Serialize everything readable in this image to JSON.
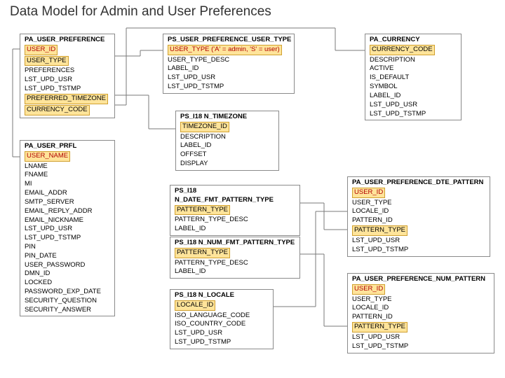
{
  "title": "Data Model for Admin and User Preferences",
  "entities": {
    "pa_user_preference": {
      "name": "PA_USER_PREFERENCE",
      "fields": [
        "USER_ID",
        "USER_TYPE",
        "PREFERENCES",
        "LST_UPD_USR",
        "LST_UPD_TSTMP",
        "PREFERRED_TIMEZONE",
        "CURRENCY_CODE"
      ],
      "key_idx": [
        0
      ],
      "hl_idx": [
        1,
        5,
        6
      ]
    },
    "pa_user_prfl": {
      "name": "PA_USER_PRFL",
      "fields": [
        "USER_NAME",
        "LNAME",
        "FNAME",
        "MI",
        "EMAIL_ADDR",
        "SMTP_SERVER",
        "EMAIL_REPLY_ADDR",
        "EMAIL_NICKNAME",
        "LST_UPD_USR",
        "LST_UPD_TSTMP",
        "PIN",
        "PIN_DATE",
        "USER_PASSWORD",
        "DMN_ID",
        "LOCKED",
        "PASSWORD_EXP_DATE",
        "SECURITY_QUESTION",
        "SECURITY_ANSWER"
      ],
      "key_idx": [
        0
      ],
      "hl_idx": []
    },
    "ps_user_preference_user_type": {
      "name": "PS_USER_PREFERENCE_USER_TYPE",
      "fields": [
        "USER_TYPE ('A' = admin, 'S' = user)",
        "USER_TYPE_DESC",
        "LABEL_ID",
        "LST_UPD_USR",
        "LST_UPD_TSTMP"
      ],
      "key_idx": [
        0
      ],
      "hl_idx": []
    },
    "ps_i18n_timezone": {
      "name": "PS_I18 N_TIMEZONE",
      "fields": [
        "TIMEZONE_ID",
        "DESCRIPTION",
        "LABEL_ID",
        "OFFSET",
        "DISPLAY"
      ],
      "key_idx": [],
      "hl_idx": [
        0
      ]
    },
    "ps_i18n_date_fmt_pattern_type": {
      "name": "PS_I18 N_DATE_FMT_PATTERN_TYPE",
      "fields": [
        "PATTERN_TYPE",
        "PATTERN_TYPE_DESC",
        "LABEL_ID"
      ],
      "key_idx": [],
      "hl_idx": [
        0
      ]
    },
    "ps_i18n_num_fmt_pattern_type": {
      "name": "PS_I18 N_NUM_FMT_PATTERN_TYPE",
      "fields": [
        "PATTERN_TYPE",
        "PATTERN_TYPE_DESC",
        "LABEL_ID"
      ],
      "key_idx": [],
      "hl_idx": [
        0
      ]
    },
    "ps_i18n_locale": {
      "name": "PS_I18 N_LOCALE",
      "fields": [
        "LOCALE_ID",
        "ISO_LANGUAGE_CODE",
        "ISO_COUNTRY_CODE",
        "LST_UPD_USR",
        "LST_UPD_TSTMP"
      ],
      "key_idx": [],
      "hl_idx": [
        0
      ]
    },
    "pa_currency": {
      "name": "PA_CURRENCY",
      "fields": [
        "CURRENCY_CODE",
        "DESCRIPTION",
        "ACTIVE",
        "IS_DEFAULT",
        "SYMBOL",
        "LABEL_ID",
        "LST_UPD_USR",
        "LST_UPD_TSTMP"
      ],
      "key_idx": [],
      "hl_idx": [
        0
      ]
    },
    "pa_user_preference_dte_pattern": {
      "name": "PA_USER_PREFERENCE_DTE_PATTERN",
      "fields": [
        "USER_ID",
        "USER_TYPE",
        "LOCALE_ID",
        "PATTERN_ID",
        "PATTERN_TYPE",
        "LST_UPD_USR",
        "LST_UPD_TSTMP"
      ],
      "key_idx": [
        0
      ],
      "hl_idx": [
        4
      ]
    },
    "pa_user_preference_num_pattern": {
      "name": "PA_USER_PREFERENCE_NUM_PATTERN",
      "fields": [
        "USER_ID",
        "USER_TYPE",
        "LOCALE_ID",
        "PATTERN_ID",
        "PATTERN_TYPE",
        "LST_UPD_USR",
        "LST_UPD_TSTMP"
      ],
      "key_idx": [
        0
      ],
      "hl_idx": [
        4
      ]
    }
  }
}
